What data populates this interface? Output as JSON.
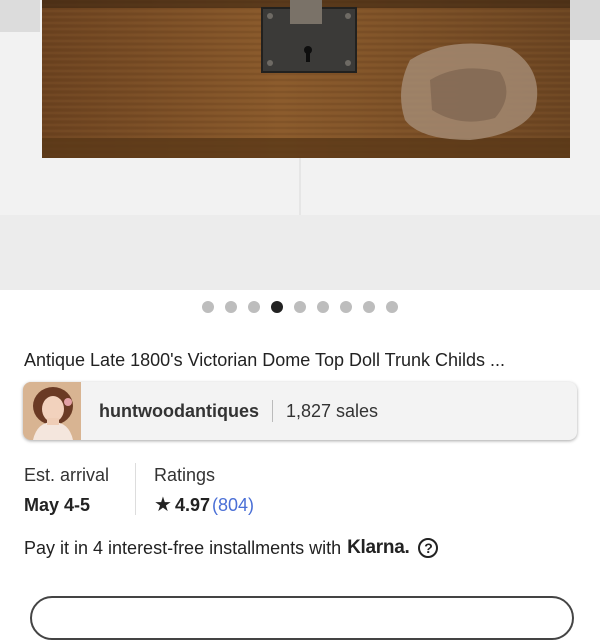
{
  "listing": {
    "title": "Antique Late 1800's Victorian Dome Top Doll Trunk Childs ...",
    "image_icon": "product-photo-wooden-trunk"
  },
  "gallery": {
    "total_images": 9,
    "active_index": 4
  },
  "shop": {
    "name": "huntwoodantiques",
    "sales": "1,827 sales",
    "avatar_icon": "shop-avatar-portrait"
  },
  "arrival": {
    "label": "Est. arrival",
    "value": "May 4-5"
  },
  "ratings": {
    "label": "Ratings",
    "value": "4.97",
    "count": "(804)",
    "star_icon": "star-icon"
  },
  "payment": {
    "text": "Pay it in 4 interest-free installments with",
    "brand": "Klarna.",
    "help_icon": "question-circle-icon",
    "help_symbol": "?"
  },
  "colors": {
    "link": "#4a6fd6",
    "dot_active": "#222222",
    "dot_inactive": "#bdbdbd"
  }
}
